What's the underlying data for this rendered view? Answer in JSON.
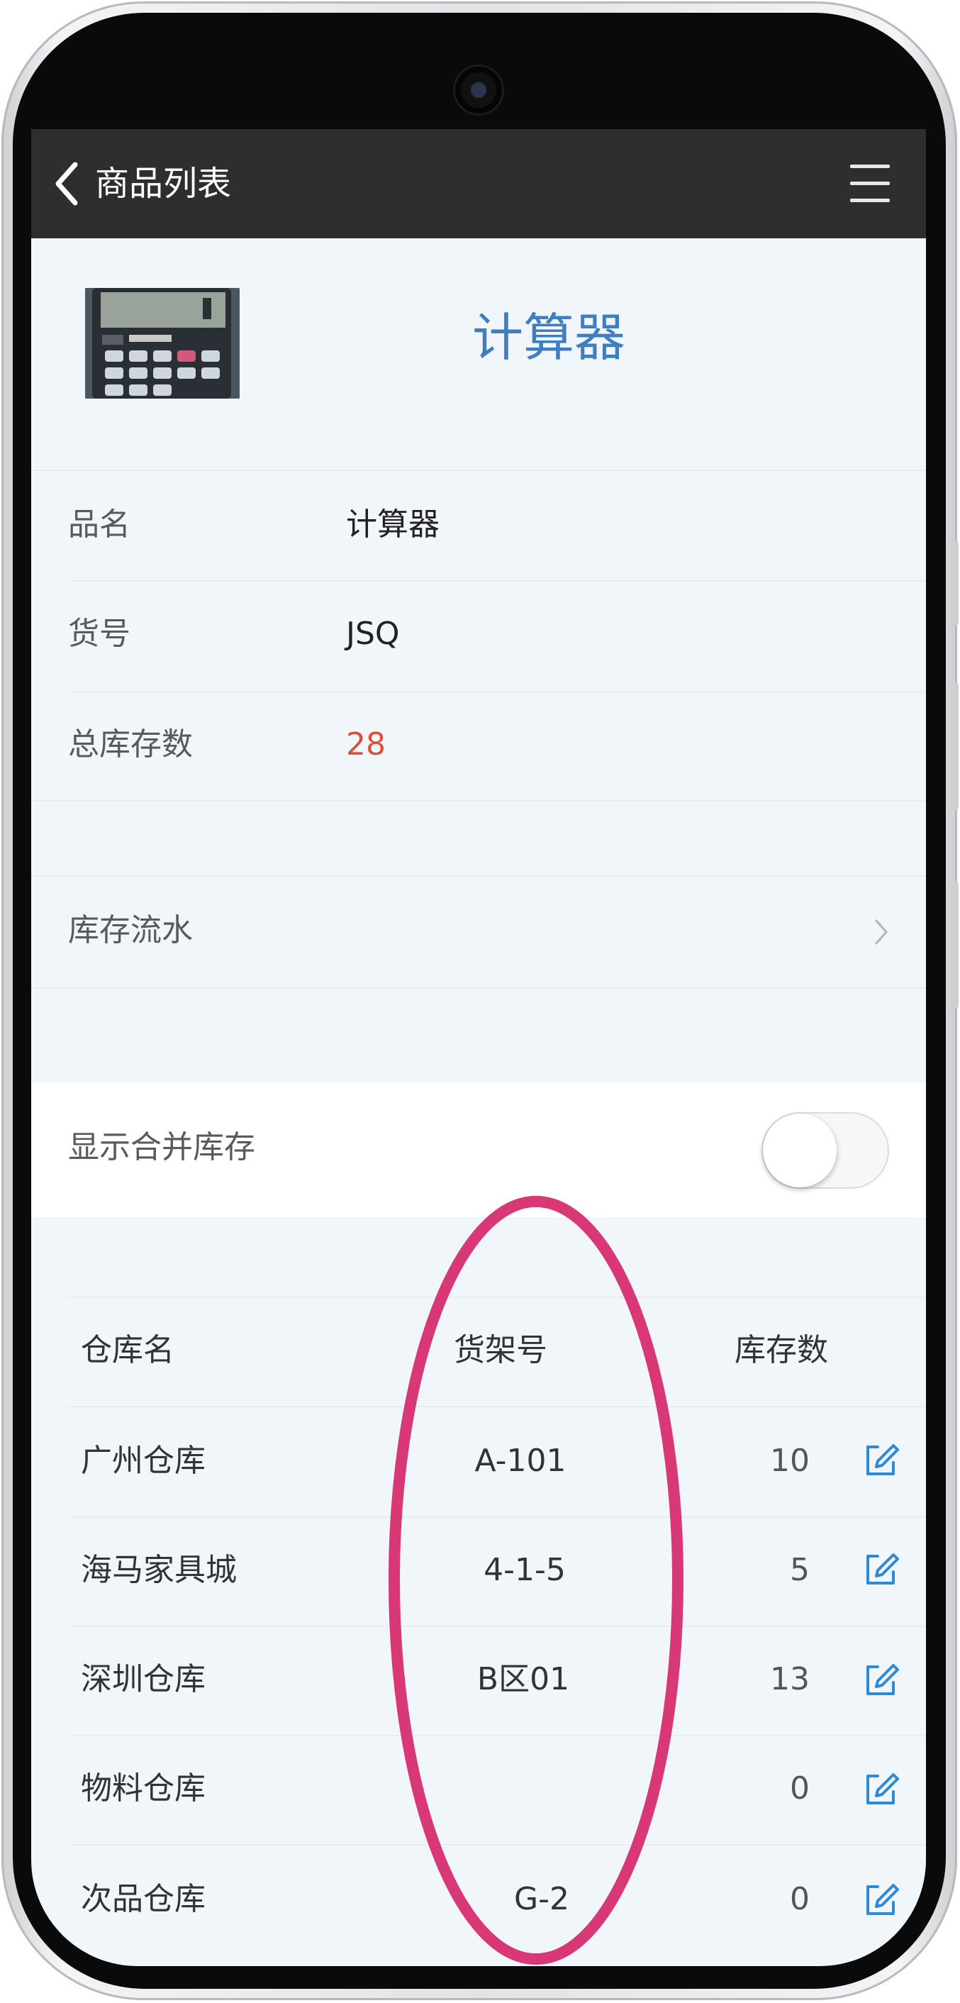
{
  "header": {
    "back_icon": "chevron-left-icon",
    "title": "商品列表",
    "menu_icon": "hamburger-menu-icon"
  },
  "product": {
    "image_icon": "calculator-photo",
    "title": "计算器"
  },
  "details": [
    {
      "label": "品名",
      "value": "计算器"
    },
    {
      "label": "货号",
      "value": "JSQ"
    },
    {
      "label": "总库存数",
      "value": "28"
    }
  ],
  "flow": {
    "label": "库存流水",
    "chevron_icon": "chevron-right-icon"
  },
  "merge": {
    "label": "显示合并库存",
    "enabled": false
  },
  "table": {
    "headers": [
      "仓库名",
      "货架号",
      "库存数"
    ],
    "rows": [
      {
        "warehouse": "广州仓库",
        "shelf": "A-101",
        "qty": "10"
      },
      {
        "warehouse": "海马家具城",
        "shelf": "4-1-5",
        "qty": "5"
      },
      {
        "warehouse": "深圳仓库",
        "shelf": "B区01",
        "qty": "13"
      },
      {
        "warehouse": "物料仓库",
        "shelf": "",
        "qty": "0"
      },
      {
        "warehouse": "次品仓库",
        "shelf": "G-2",
        "qty": "0"
      }
    ]
  },
  "colors": {
    "accent_blue": "#3f7fbf",
    "stock_red": "#d9513a",
    "annotation_pink": "#d83876",
    "header_bg": "#2e2e2e"
  }
}
